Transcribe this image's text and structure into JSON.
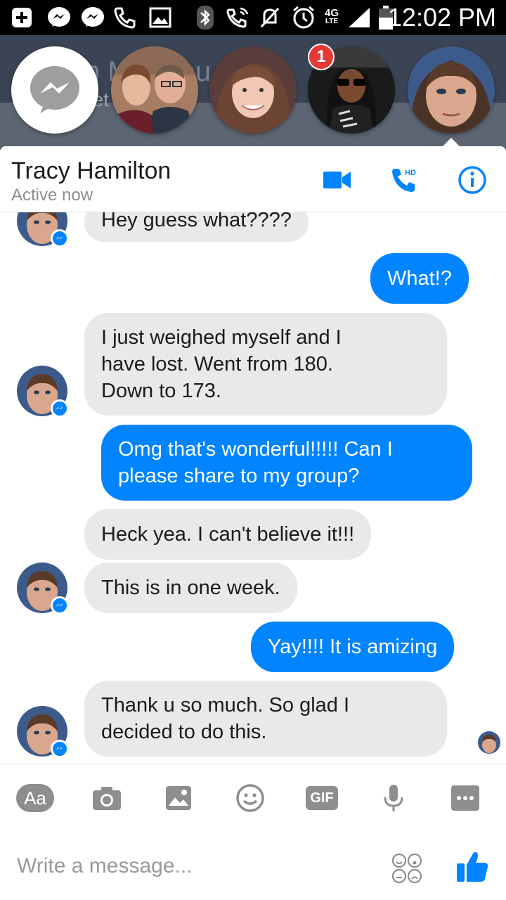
{
  "status_bar": {
    "time": "12:02 PM",
    "network": "4G",
    "network_sub": "LTE"
  },
  "background": {
    "title": "n M  tru   ou",
    "group_label": "Secret Group"
  },
  "chat_heads": {
    "badge_count": "1"
  },
  "header": {
    "contact_name": "Tracy Hamilton",
    "contact_status": "Active now",
    "call_hd_label": "HD"
  },
  "messages": [
    {
      "from": "them",
      "text": "Hey guess what????"
    },
    {
      "from": "me",
      "text": "What!?"
    },
    {
      "from": "them",
      "text": "I just weighed myself and I\nhave lost.  Went from 180.\nDown to 173."
    },
    {
      "from": "me",
      "text": "Omg that's wonderful!!!!! Can I\nplease share to my group?"
    },
    {
      "from": "them",
      "text": "Heck yea.  I can't believe it!!!"
    },
    {
      "from": "them",
      "text": "This is in one week."
    },
    {
      "from": "me",
      "text": "Yay!!!! It is amizing"
    },
    {
      "from": "them",
      "text": "Thank u so much.  So glad I\ndecided to do this."
    }
  ],
  "toolbar": {
    "text_label": "Aa",
    "gif_label": "GIF"
  },
  "composer": {
    "placeholder": "Write a message..."
  },
  "colors": {
    "accent": "#0084ff",
    "incoming_bubble": "#e9e9eb",
    "badge": "#e53935"
  }
}
